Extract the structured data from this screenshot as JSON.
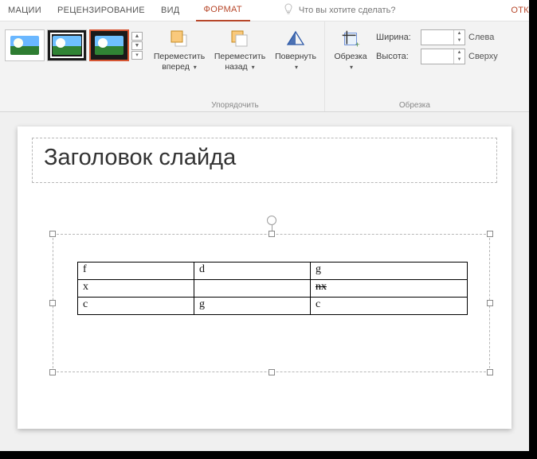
{
  "ribbon_tabs": {
    "animations": "МАЦИИ",
    "review": "РЕЦЕНЗИРОВАНИЕ",
    "view": "ВИД",
    "format": "ФОРМАТ",
    "tell_me_placeholder": "Что вы хотите сделать?",
    "right_cut": "ОТК"
  },
  "ribbon": {
    "arrange": {
      "bring_forward_l1": "Переместить",
      "bring_forward_l2": "вперед",
      "send_backward_l1": "Переместить",
      "send_backward_l2": "назад",
      "rotate": "Повернуть",
      "group_label": "Упорядочить"
    },
    "crop": {
      "crop": "Обрезка",
      "width_label": "Ширина:",
      "height_label": "Высота:",
      "left_label": "Слева",
      "top_label": "Сверху",
      "group_label": "Обрезка"
    }
  },
  "slide": {
    "title": "Заголовок слайда",
    "table": {
      "rows": [
        {
          "c1": "f",
          "c2": "d",
          "c3": "g"
        },
        {
          "c1": "x",
          "c2": "",
          "c3": "nx",
          "c3_strike": true
        },
        {
          "c1": "c",
          "c2": "g",
          "c3": "c"
        }
      ]
    }
  }
}
